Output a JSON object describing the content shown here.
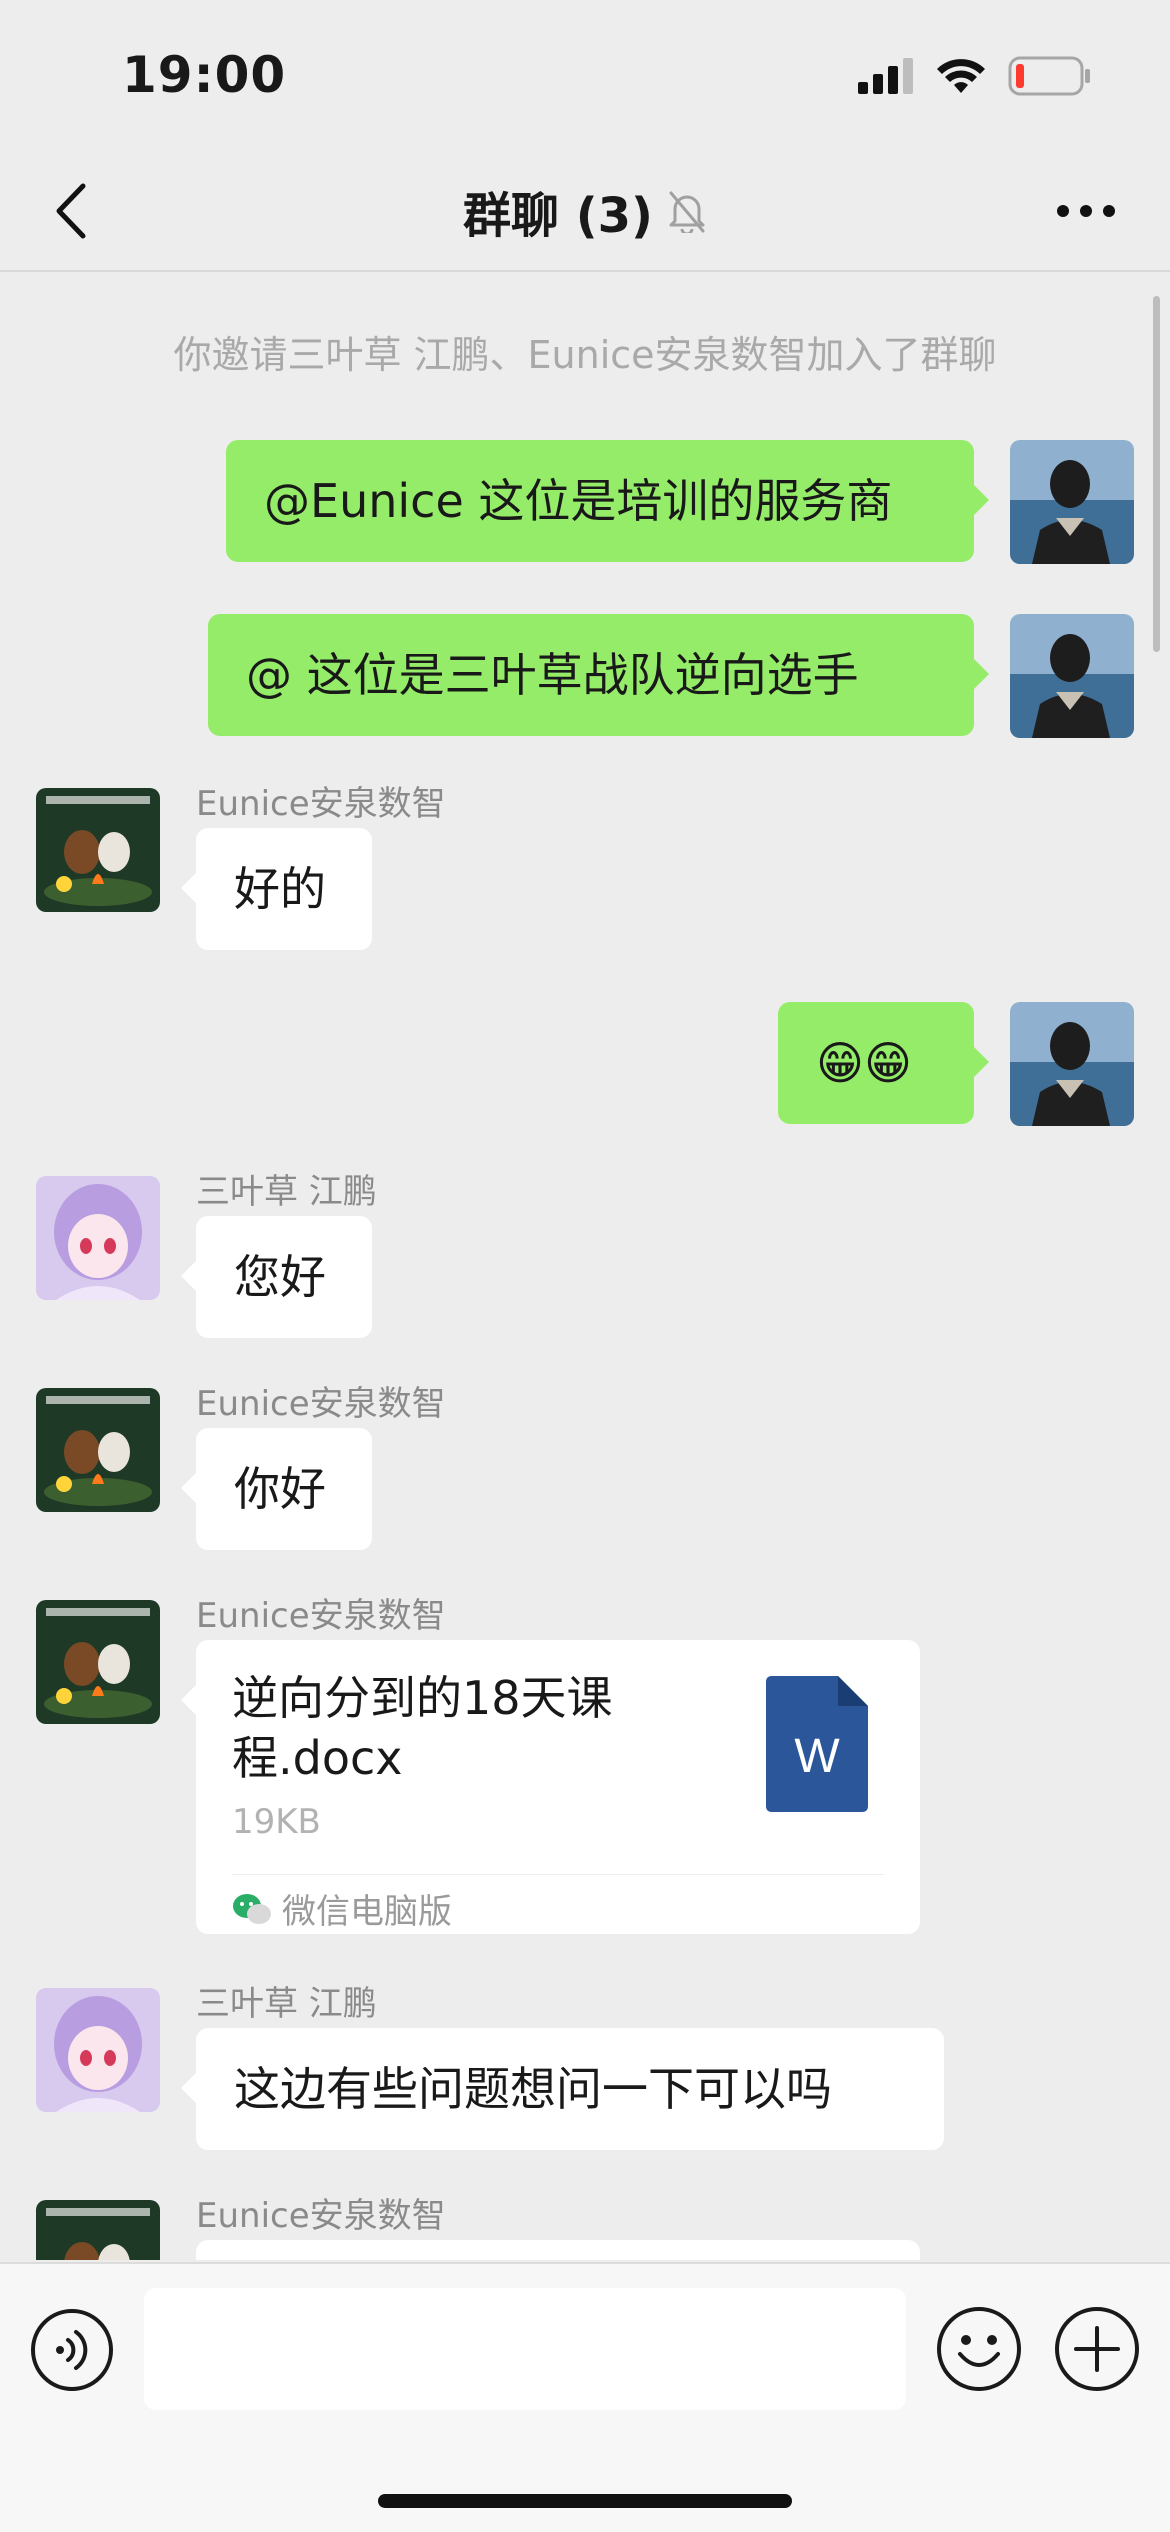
{
  "status": {
    "time": "19:00"
  },
  "nav": {
    "title": "群聊 (3)"
  },
  "system_message": "你邀请三叶草 江鹏、Eunice安泉数智加入了群聊",
  "messages": [
    {
      "sender": "me",
      "text": "@Eunice 这位是培训的服务商"
    },
    {
      "sender": "me",
      "text": "@  这位是三叶草战队逆向选手"
    },
    {
      "sender": "Eunice安泉数智",
      "text": "好的"
    },
    {
      "sender": "me",
      "text": "😁😁"
    },
    {
      "sender": "三叶草 江鹏",
      "text": "您好"
    },
    {
      "sender": "Eunice安泉数智",
      "text": "你好"
    },
    {
      "sender": "Eunice安泉数智",
      "file": {
        "name": "逆向分到的18天课程.docx",
        "size": "19KB",
        "source": "微信电脑版",
        "icon_letter": "W"
      }
    },
    {
      "sender": "三叶草 江鹏",
      "text": "这边有些问题想问一下可以吗"
    },
    {
      "sender": "Eunice安泉数智",
      "text": ""
    }
  ],
  "icons": {
    "back": "chevron-left-icon",
    "mute": "bell-off-icon",
    "more": "ellipsis-icon",
    "voice": "voice-icon",
    "emoji": "emoji-icon",
    "plus": "plus-icon"
  },
  "colors": {
    "outgoing_bubble": "#95ec69",
    "incoming_bubble": "#ffffff",
    "background": "#ededed",
    "word_icon": "#2b579a"
  }
}
